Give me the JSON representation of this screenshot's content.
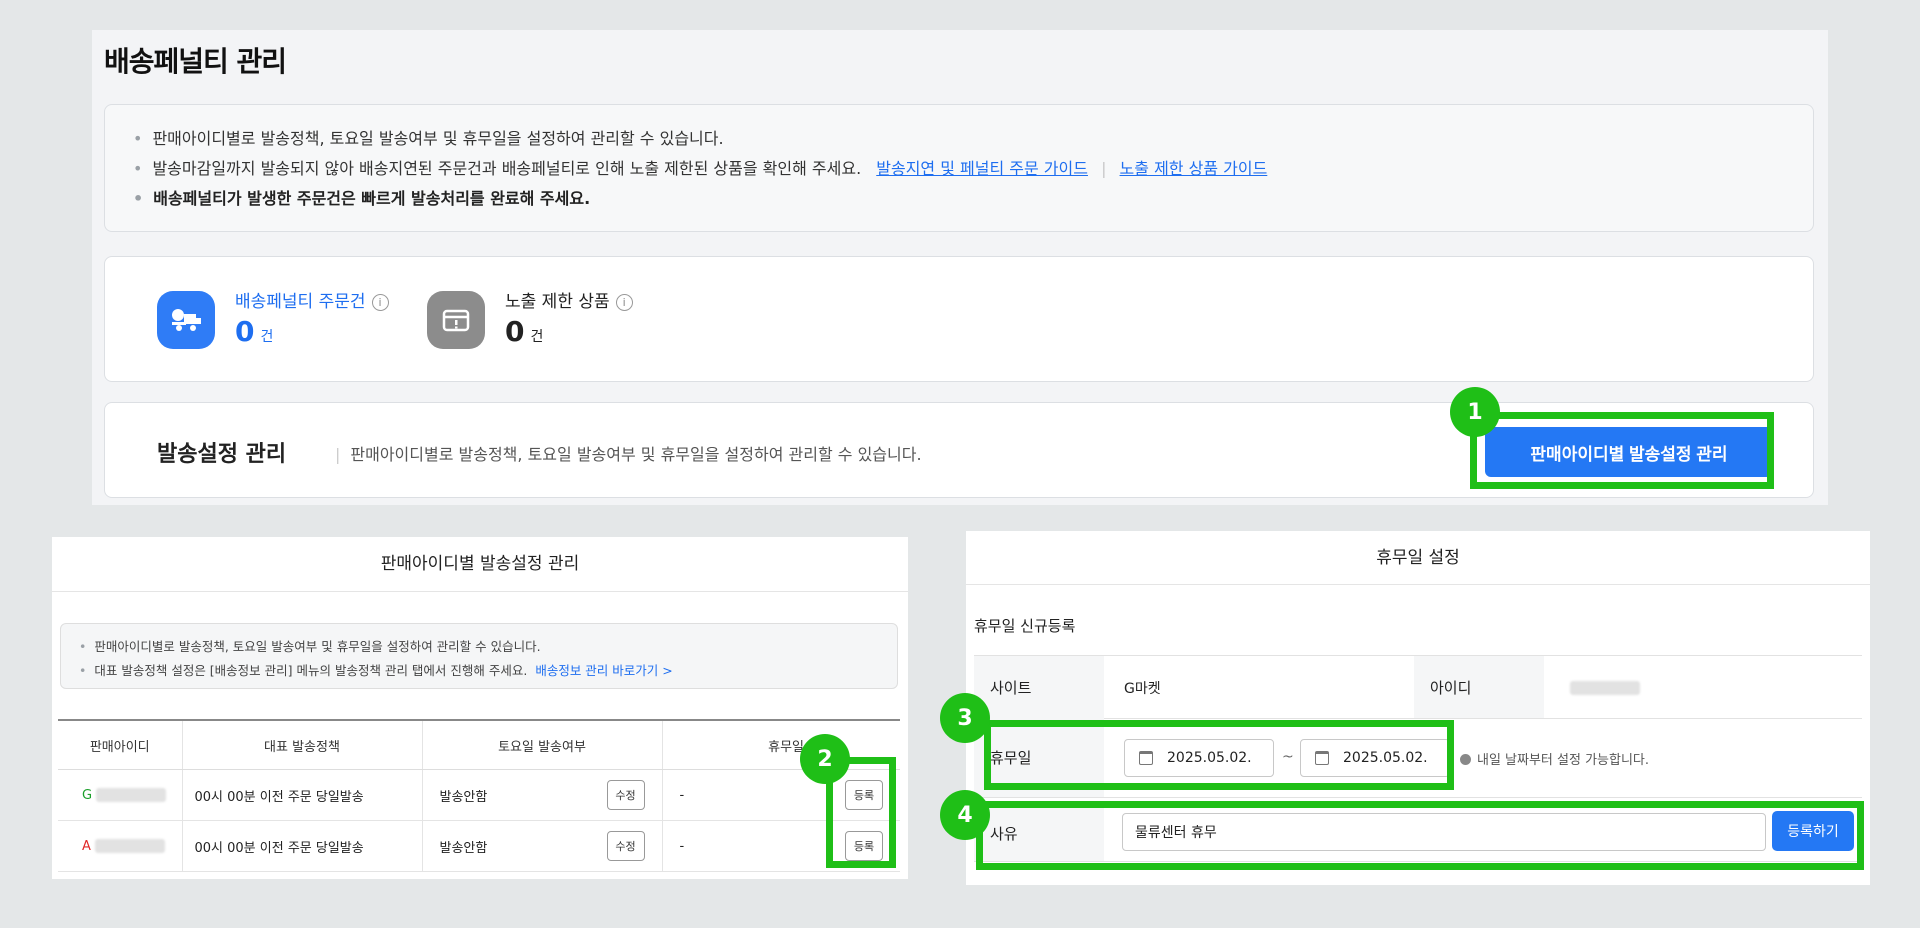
{
  "main": {
    "title": "배송페널티 관리",
    "notices": [
      "판매아이디별로 발송정책, 토요일 발송여부 및 휴무일을 설정하여 관리할 수 있습니다.",
      "발송마감일까지 발송되지 않아 배송지연된 주문건과 배송페널티로 인해 노출 제한된 상품을 확인해 주세요.",
      "배송페널티가 발생한 주문건은 빠르게 발송처리를 완료해 주세요."
    ],
    "links": [
      "발송지연 및 페널티 주문 가이드",
      "노출 제한 상품 가이드"
    ],
    "stats": [
      {
        "label": "배송페널티 주문건",
        "value": "0",
        "unit": "건",
        "icon": "delivery-truck-icon"
      },
      {
        "label": "노출 제한 상품",
        "value": "0",
        "unit": "건",
        "icon": "restricted-product-icon"
      }
    ],
    "shipping": {
      "title": "발송설정 관리",
      "desc": "판매아이디별로 발송정책, 토요일 발송여부 및 휴무일을 설정하여 관리할 수 있습니다.",
      "button": "판매아이디별 발송설정 관리"
    }
  },
  "annotations": [
    "1",
    "2",
    "3",
    "4"
  ],
  "left_panel": {
    "title": "판매아이디별 발송설정 관리",
    "notices": [
      "판매아이디별로 발송정책, 토요일 발송여부 및 휴무일을 설정하여 관리할 수 있습니다.",
      "대표 발송정책 설정은 [배송정보 관리] 메뉴의 발송정책 관리 탭에서 진행해 주세요."
    ],
    "link": "배송정보 관리 바로가기 >",
    "headers": [
      "판매아이디",
      "대표 발송정책",
      "토요일 발송여부",
      "휴무일"
    ],
    "rows": [
      {
        "prefix": "G",
        "policy": "00시 00분 이전 주문 당일발송",
        "saturday": "발송안함",
        "edit": "수정",
        "holiday": "-",
        "register": "등록"
      },
      {
        "prefix": "A",
        "policy": "00시 00분 이전 주문 당일발송",
        "saturday": "발송안함",
        "edit": "수정",
        "holiday": "-",
        "register": "등록"
      }
    ]
  },
  "right_panel": {
    "title": "휴무일 설정",
    "section": "휴무일 신규등록",
    "site_label": "사이트",
    "site_value": "G마켓",
    "id_label": "아이디",
    "holiday_label": "휴무일",
    "start_date": "2025.05.02.",
    "tilde": "~",
    "end_date": "2025.05.02.",
    "date_hint": "내일 날짜부터 설정 가능합니다.",
    "reason_label": "사유",
    "reason_value": "물류센터 휴무",
    "register_btn": "등록하기"
  },
  "colors": {
    "accent": "#2478f4",
    "highlight": "#1fbf17"
  }
}
